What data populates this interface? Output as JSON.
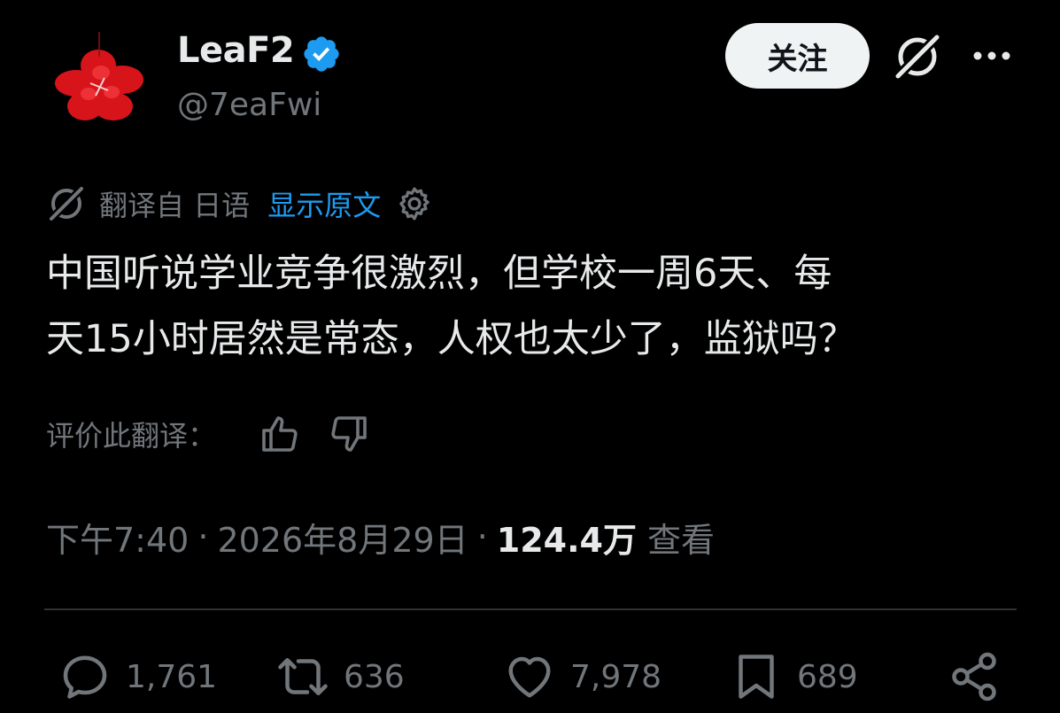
{
  "author": {
    "display_name": "LeaF2",
    "handle": "@7eaFwi",
    "verified_icon": "verified-badge-icon",
    "verified_color": "#1d9bf0"
  },
  "header": {
    "follow_label": "关注",
    "grok_icon": "grok-icon",
    "more_icon": "more-icon"
  },
  "translation": {
    "translated_from": "翻译自 日语",
    "show_original": "显示原文",
    "settings_icon": "gear-icon"
  },
  "tweet": {
    "text_lines": [
      "中国听说学业竞争很激烈，但学校一周6天、每",
      "天15小时居然是常态，人权也太少了，监狱吗？"
    ]
  },
  "rating": {
    "label": "评价此翻译：",
    "thumbs_up_icon": "thumbs-up-icon",
    "thumbs_down_icon": "thumbs-down-icon"
  },
  "meta": {
    "time": "下午7:40",
    "separator": "·",
    "date": "2026年8月29日",
    "views_count": "124.4万",
    "views_label": "查看"
  },
  "actions": {
    "replies": "1,761",
    "retweets": "636",
    "likes": "7,978",
    "bookmarks": "689"
  },
  "colors": {
    "background": "#000000",
    "text_primary": "#e7e9ea",
    "text_secondary": "#71767b",
    "accent": "#1d9bf0",
    "divider": "#2f3336"
  }
}
